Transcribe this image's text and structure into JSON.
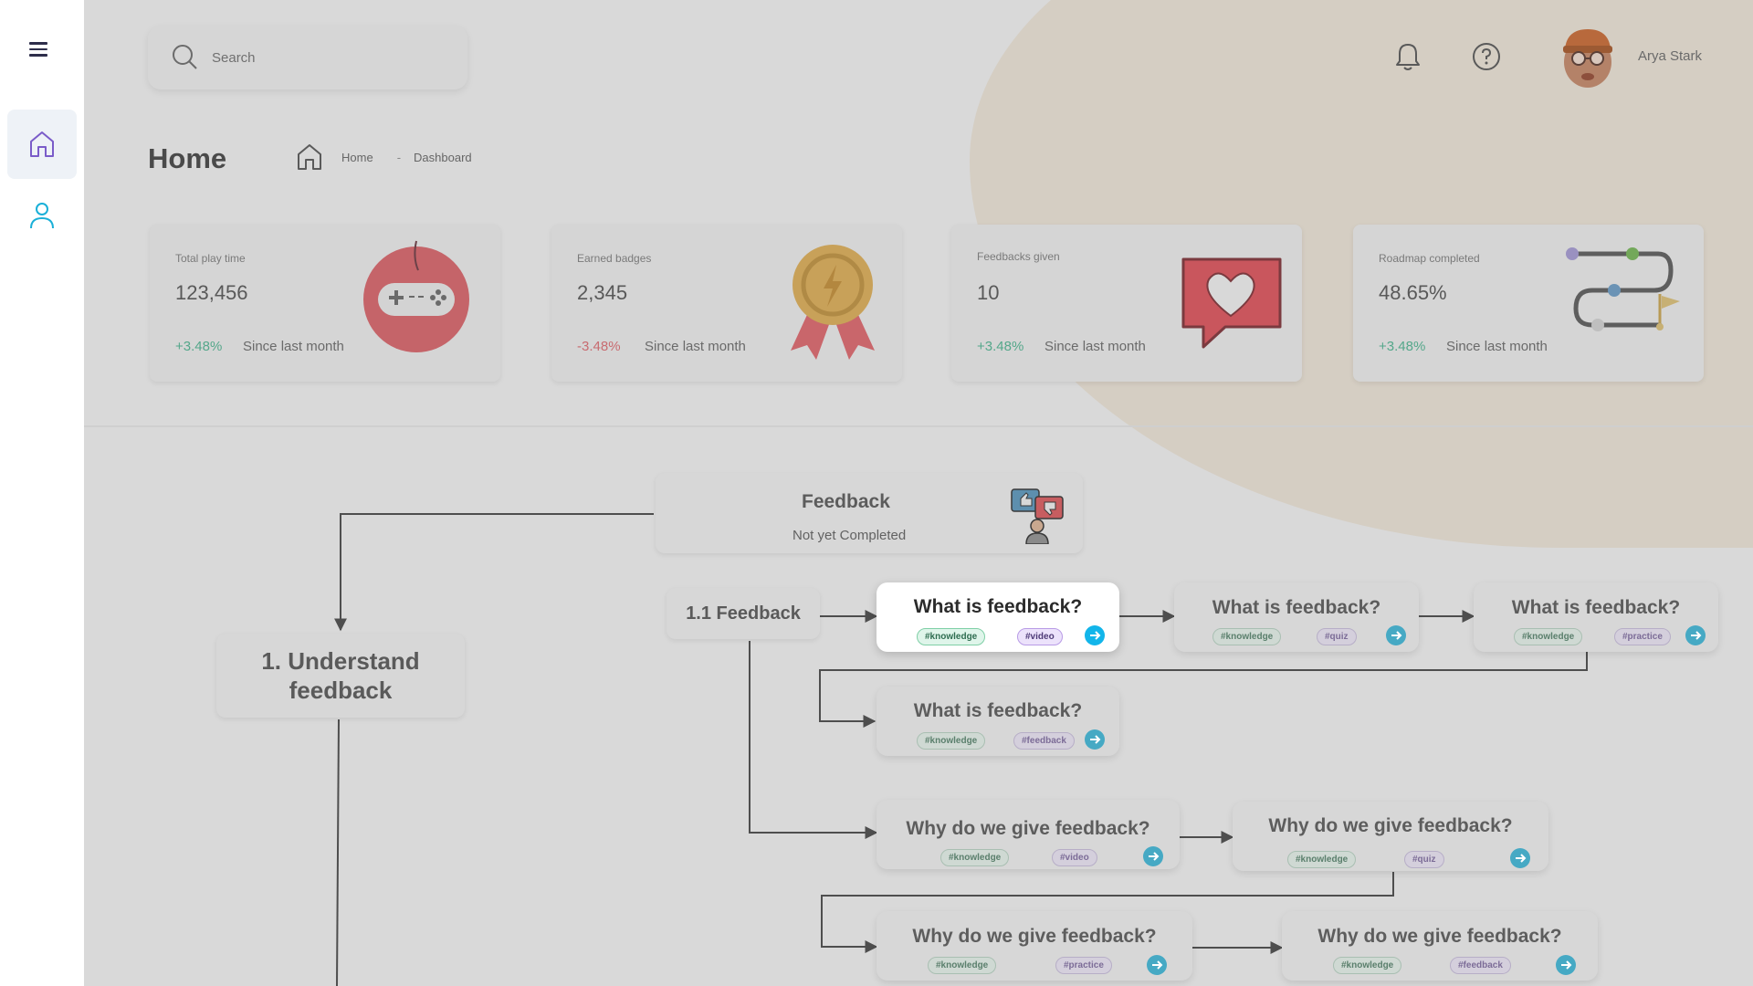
{
  "sidebar": {
    "items": [
      {
        "id": "home",
        "icon": "home-icon",
        "active": true
      },
      {
        "id": "profile",
        "icon": "user-icon",
        "active": false
      }
    ]
  },
  "header": {
    "search": {
      "placeholder": "Search",
      "value": ""
    },
    "user": {
      "name": "Arya Stark"
    }
  },
  "page": {
    "title": "Home",
    "breadcrumb": {
      "home": "Home",
      "sep": "-",
      "current": "Dashboard"
    }
  },
  "stats": [
    {
      "label": "Total play time",
      "value": "123,456",
      "change": "+3.48%",
      "trend": "positive",
      "since": "Since last month",
      "icon": "gamepad-icon"
    },
    {
      "label": "Earned badges",
      "value": "2,345",
      "change": "-3.48%",
      "trend": "negative",
      "since": "Since last month",
      "icon": "medal-icon"
    },
    {
      "label": "Feedbacks given",
      "value": "10",
      "change": "+3.48%",
      "trend": "positive",
      "since": "Since last month",
      "icon": "heart-chat-icon"
    },
    {
      "label": "Roadmap completed",
      "value": "48.65%",
      "change": "+3.48%",
      "trend": "positive",
      "since": "Since last month",
      "icon": "roadmap-icon"
    }
  ],
  "flow": {
    "root": {
      "title": "Feedback",
      "status": "Not yet Completed"
    },
    "module": {
      "title": "1. Understand feedback"
    },
    "submodule": {
      "title": "1.1 Feedback"
    },
    "lessons": [
      {
        "title": "What is feedback?",
        "tags": [
          "#knowledge",
          "#video"
        ],
        "active": true
      },
      {
        "title": "What is feedback?",
        "tags": [
          "#knowledge",
          "#quiz"
        ]
      },
      {
        "title": "What is feedback?",
        "tags": [
          "#knowledge",
          "#practice"
        ]
      },
      {
        "title": "What is feedback?",
        "tags": [
          "#knowledge",
          "#feedback"
        ]
      },
      {
        "title": "Why do we give feedback?",
        "tags": [
          "#knowledge",
          "#video"
        ]
      },
      {
        "title": "Why do we give feedback?",
        "tags": [
          "#knowledge",
          "#quiz"
        ]
      },
      {
        "title": "Why do we give feedback?",
        "tags": [
          "#knowledge",
          "#practice"
        ]
      },
      {
        "title": "Why do we give feedback?",
        "tags": [
          "#knowledge",
          "#feedback"
        ]
      }
    ]
  },
  "colors": {
    "overlay": "#d9d9d9",
    "accent_cyan": "#12b5ea",
    "positive": "#54a78a",
    "negative": "#c86b70"
  }
}
